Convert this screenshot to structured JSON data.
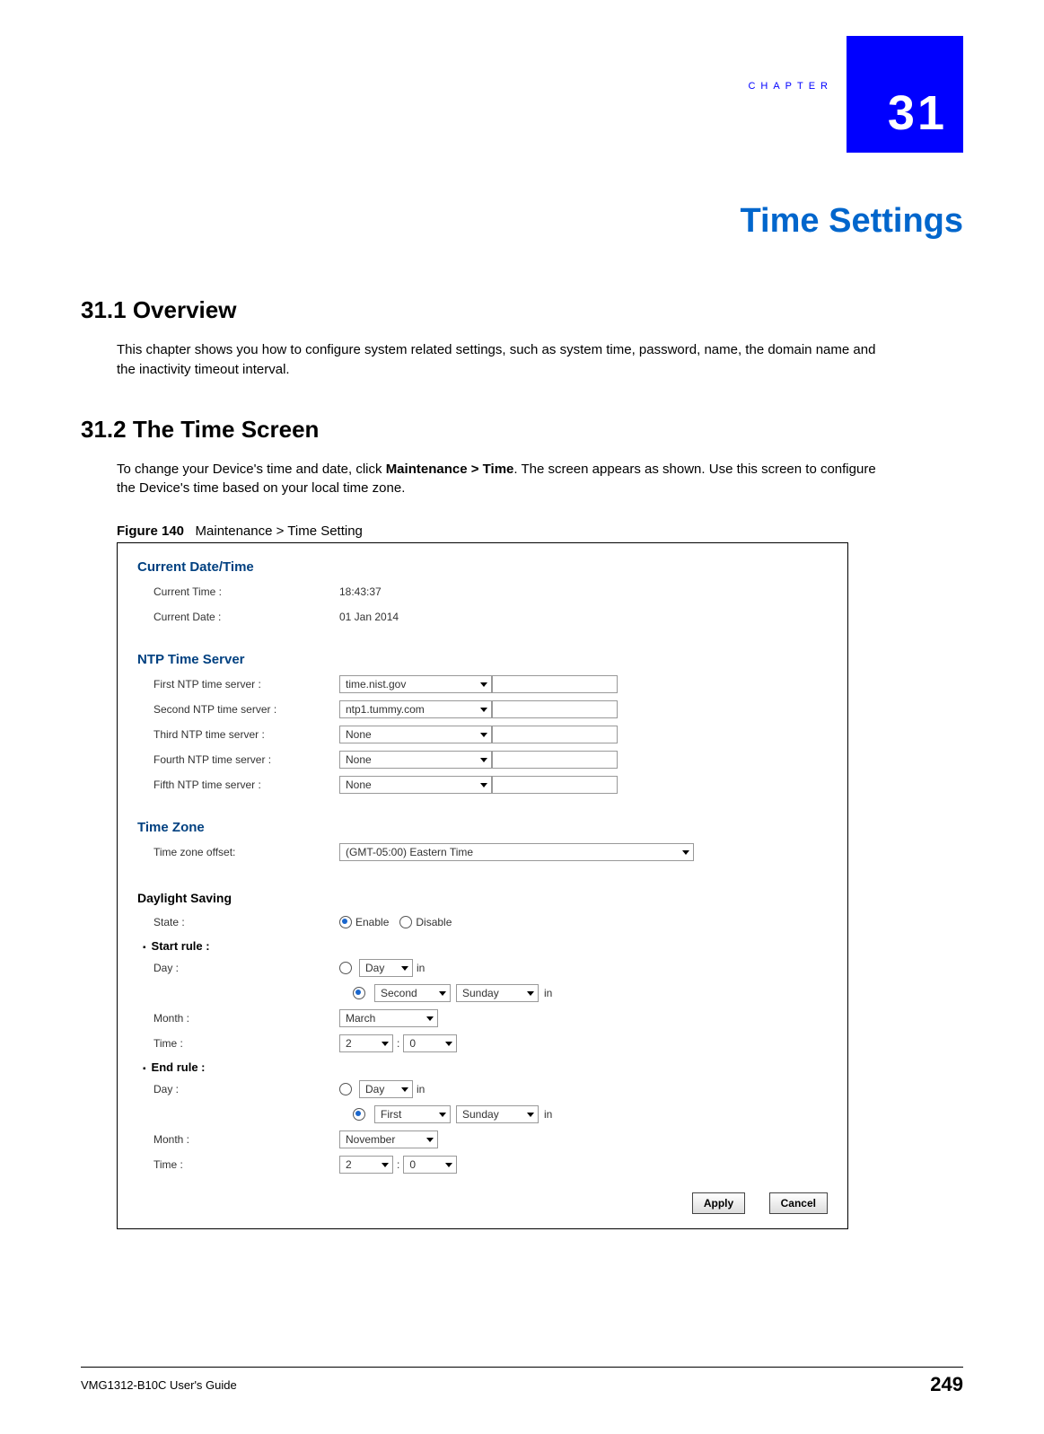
{
  "chapter": {
    "number": "31",
    "label": "CHAPTER"
  },
  "page_title": "Time Settings",
  "sec1": {
    "heading": "31.1  Overview",
    "body": "This chapter shows you how to configure system related settings, such as system time, password, name, the domain name and the inactivity timeout interval."
  },
  "sec2": {
    "heading": "31.2  The Time Screen",
    "body_prefix": "To change your Device's time and date, click ",
    "body_bold": "Maintenance > Time",
    "body_suffix": ". The screen appears as shown. Use this screen to configure the Device's time based on your local time zone.",
    "figure_label": "Figure 140",
    "figure_caption": "Maintenance > Time Setting"
  },
  "screenshot": {
    "current": {
      "title": "Current Date/Time",
      "time_label": "Current Time :",
      "time_value": "18:43:37",
      "date_label": "Current Date :",
      "date_value": "01 Jan 2014"
    },
    "ntp": {
      "title": "NTP Time Server",
      "rows": [
        {
          "label": "First NTP time server :",
          "value": "time.nist.gov"
        },
        {
          "label": "Second NTP time server :",
          "value": "ntp1.tummy.com"
        },
        {
          "label": "Third NTP time server :",
          "value": "None"
        },
        {
          "label": "Fourth NTP time server :",
          "value": "None"
        },
        {
          "label": "Fifth NTP time server :",
          "value": "None"
        }
      ]
    },
    "tz": {
      "title": "Time Zone",
      "label": "Time zone offset:",
      "value": "(GMT-05:00) Eastern Time"
    },
    "dst": {
      "title": "Daylight Saving",
      "state_label": "State :",
      "enable": "Enable",
      "disable": "Disable",
      "start_rule": "Start rule :",
      "end_rule": "End rule :",
      "day_label": "Day :",
      "day_sel": "Day",
      "in": "in",
      "month_label": "Month :",
      "time_label": "Time :",
      "start": {
        "ord": "Second",
        "weekday": "Sunday",
        "month": "March",
        "hour": "2",
        "minute": "0"
      },
      "end": {
        "ord": "First",
        "weekday": "Sunday",
        "month": "November",
        "hour": "2",
        "minute": "0"
      },
      "colon": ":"
    },
    "buttons": {
      "apply": "Apply",
      "cancel": "Cancel"
    }
  },
  "footer": {
    "guide": "VMG1312-B10C User's Guide",
    "page": "249"
  }
}
